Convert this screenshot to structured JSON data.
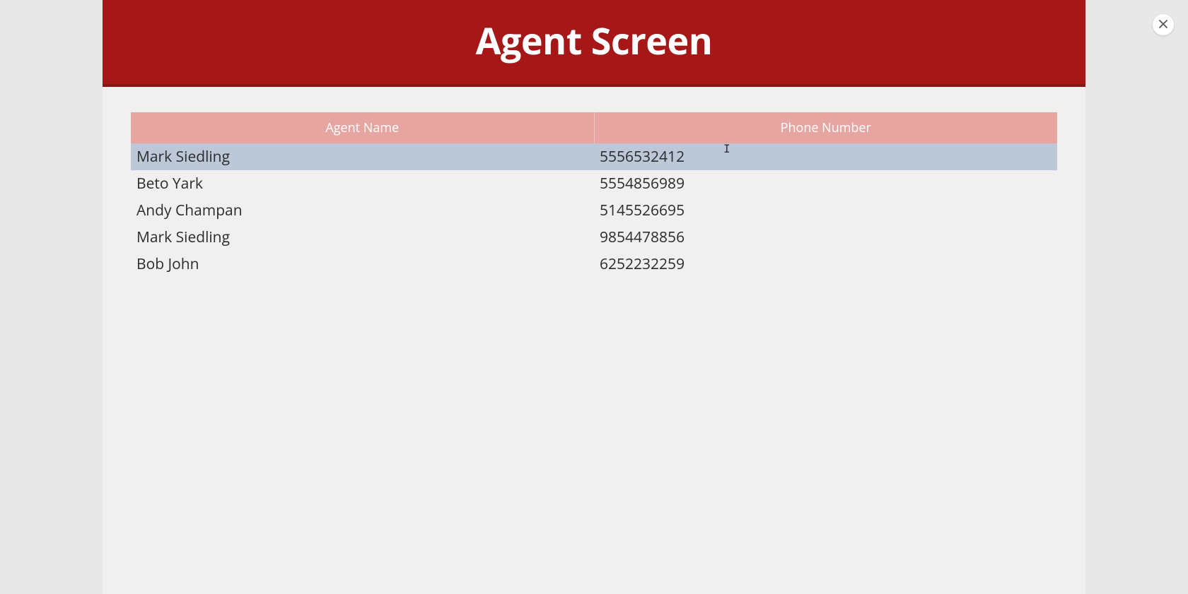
{
  "header": {
    "title": "Agent Screen"
  },
  "table": {
    "columns": [
      {
        "label": "Agent Name"
      },
      {
        "label": "Phone Number"
      }
    ],
    "rows": [
      {
        "name": "Mark Siedling",
        "phone": "5556532412",
        "selected": true
      },
      {
        "name": "Beto Yark",
        "phone": "5554856989",
        "selected": false
      },
      {
        "name": "Andy Champan",
        "phone": "5145526695",
        "selected": false
      },
      {
        "name": "Mark Siedling",
        "phone": "9854478856",
        "selected": false
      },
      {
        "name": "Bob John",
        "phone": "6252232259",
        "selected": false
      }
    ]
  },
  "close_button": {
    "label": "Close"
  }
}
